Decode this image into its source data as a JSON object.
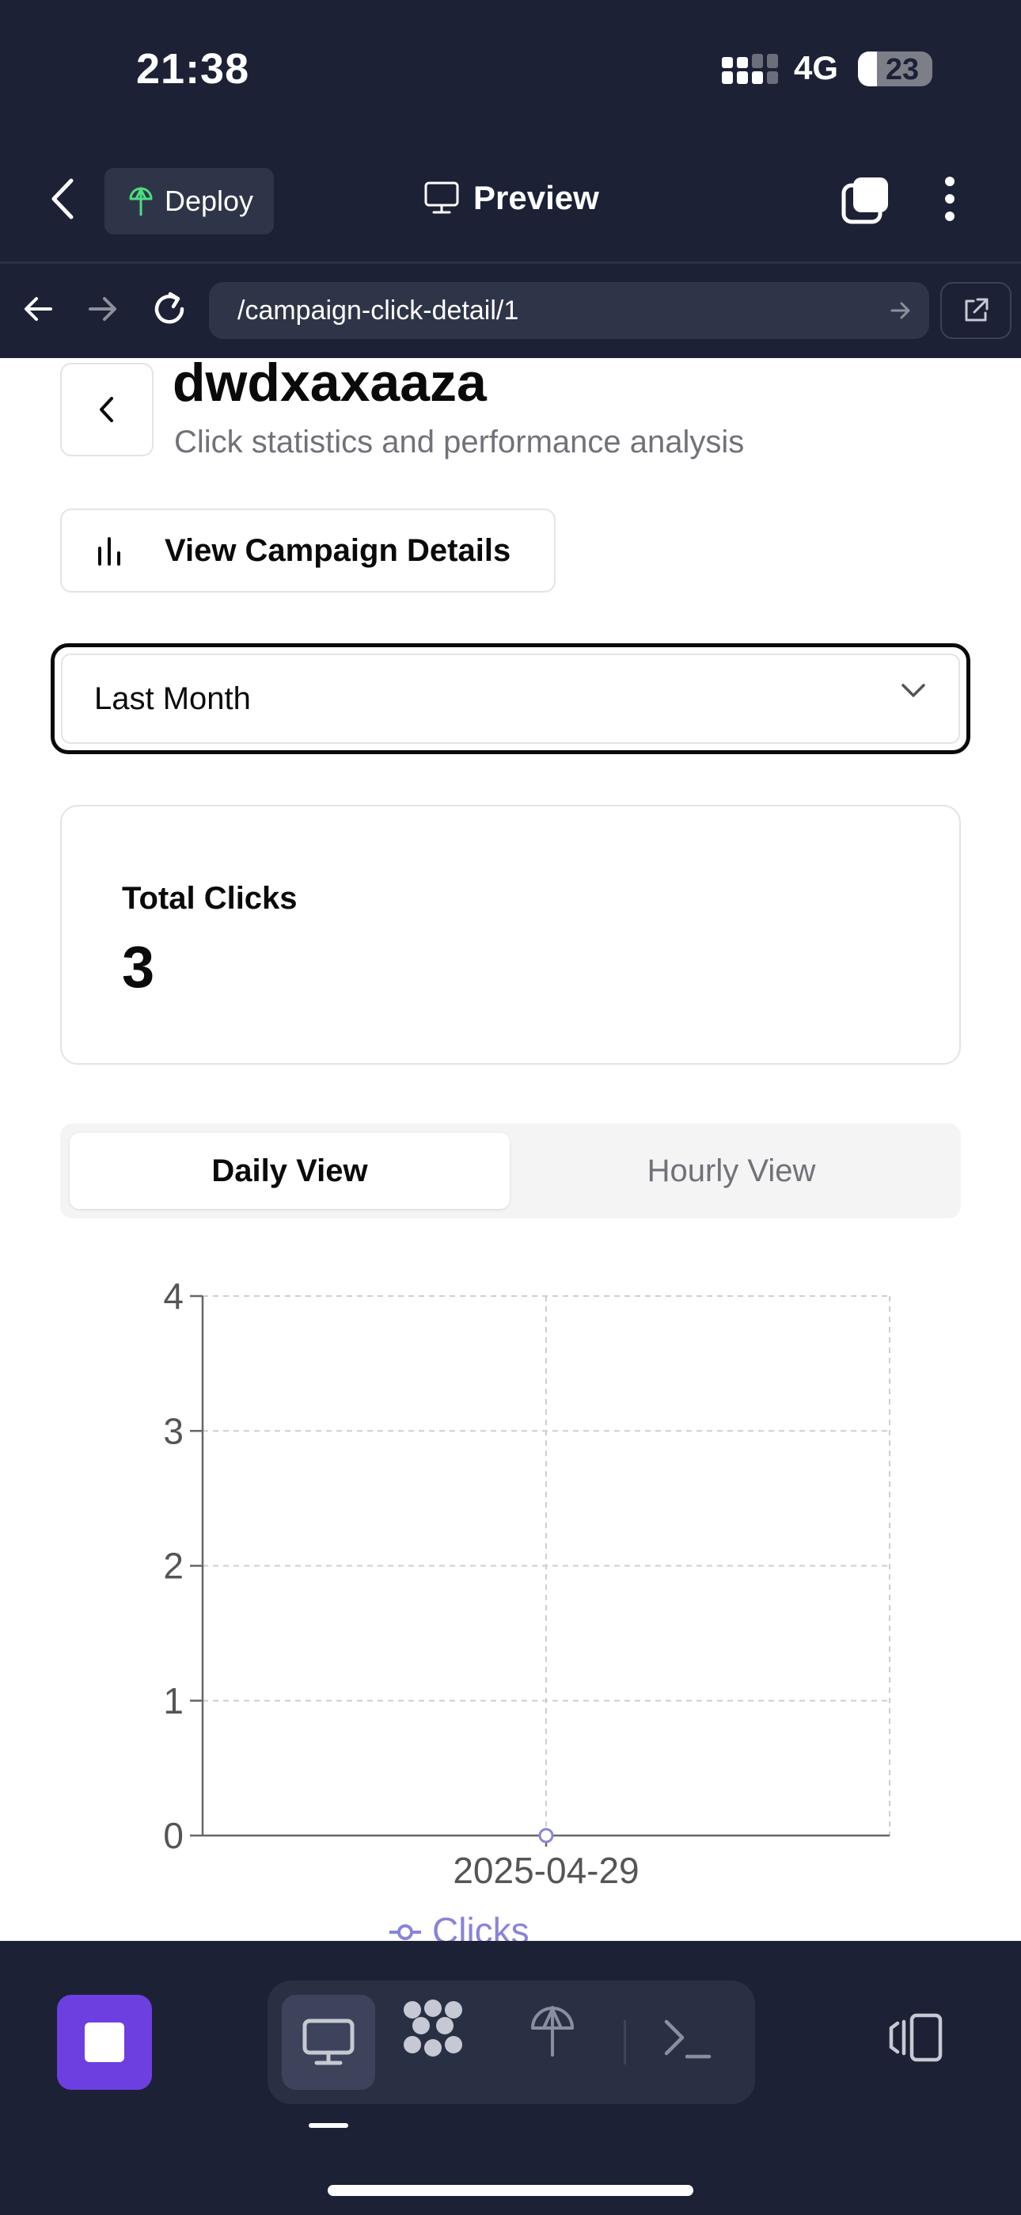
{
  "status_bar": {
    "time": "21:38",
    "network": "4G",
    "battery": "23"
  },
  "header": {
    "deploy_label": "Deploy",
    "preview_label": "Preview"
  },
  "browser": {
    "url": "/campaign-click-detail/1"
  },
  "page": {
    "title": "dwdxaxaaza",
    "subtitle": "Click statistics and performance analysis",
    "view_details_label": "View Campaign Details",
    "range_select_value": "Last Month",
    "total_clicks_label": "Total Clicks",
    "total_clicks_value": "3",
    "tabs": {
      "daily": "Daily View",
      "hourly": "Hourly View"
    },
    "active_tab": "daily"
  },
  "icons": {
    "header": [
      "chevron-left-icon",
      "deploy-icon",
      "monitor-icon",
      "tabs-icon",
      "more-vertical-icon"
    ],
    "browser": [
      "arrow-left-icon",
      "arrow-right-icon",
      "reload-icon",
      "arrow-right-icon",
      "external-link-icon"
    ],
    "page": [
      "chevron-left-icon",
      "bar-chart-icon",
      "chevron-down-icon"
    ],
    "toolbar": [
      "stop-icon",
      "monitor-icon",
      "apps-icon",
      "deploy-icon",
      "terminal-icon",
      "devices-icon"
    ]
  },
  "colors": {
    "chrome_bg": "#1c2136",
    "accent_purple": "#6d3fe0",
    "series_color": "#8884d8",
    "deploy_green": "#4ade80"
  },
  "chart_data": {
    "type": "line",
    "x": [
      "2025-04-29"
    ],
    "series": [
      {
        "name": "Clicks",
        "values": [
          0
        ]
      }
    ],
    "y_ticks": [
      0,
      1,
      2,
      3,
      4
    ],
    "ylim": [
      0,
      4
    ],
    "grid": true,
    "legend": "bottom"
  }
}
